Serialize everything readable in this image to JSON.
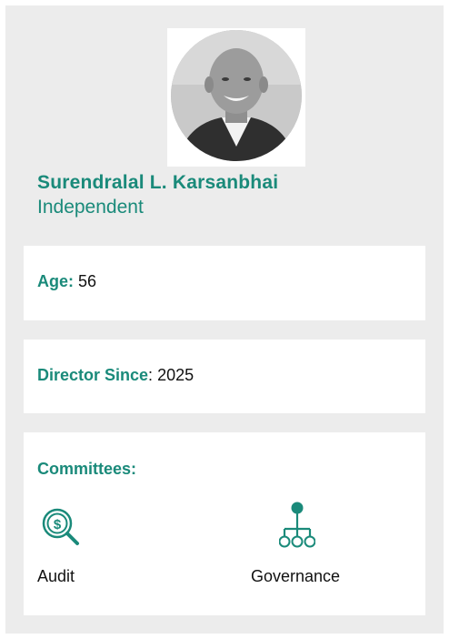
{
  "profile": {
    "name": "Surendralal L. Karsanbhai",
    "status": "Independent"
  },
  "age": {
    "label": "Age:",
    "value": "56"
  },
  "director_since": {
    "label": "Director Since",
    "value": "2025"
  },
  "committees": {
    "title": "Committees:",
    "items": [
      {
        "label": "Audit",
        "icon": "magnifier-dollar-icon"
      },
      {
        "label": "Governance",
        "icon": "org-chart-icon"
      }
    ]
  },
  "colors": {
    "accent": "#1a8a7a",
    "panel": "#ececec"
  }
}
